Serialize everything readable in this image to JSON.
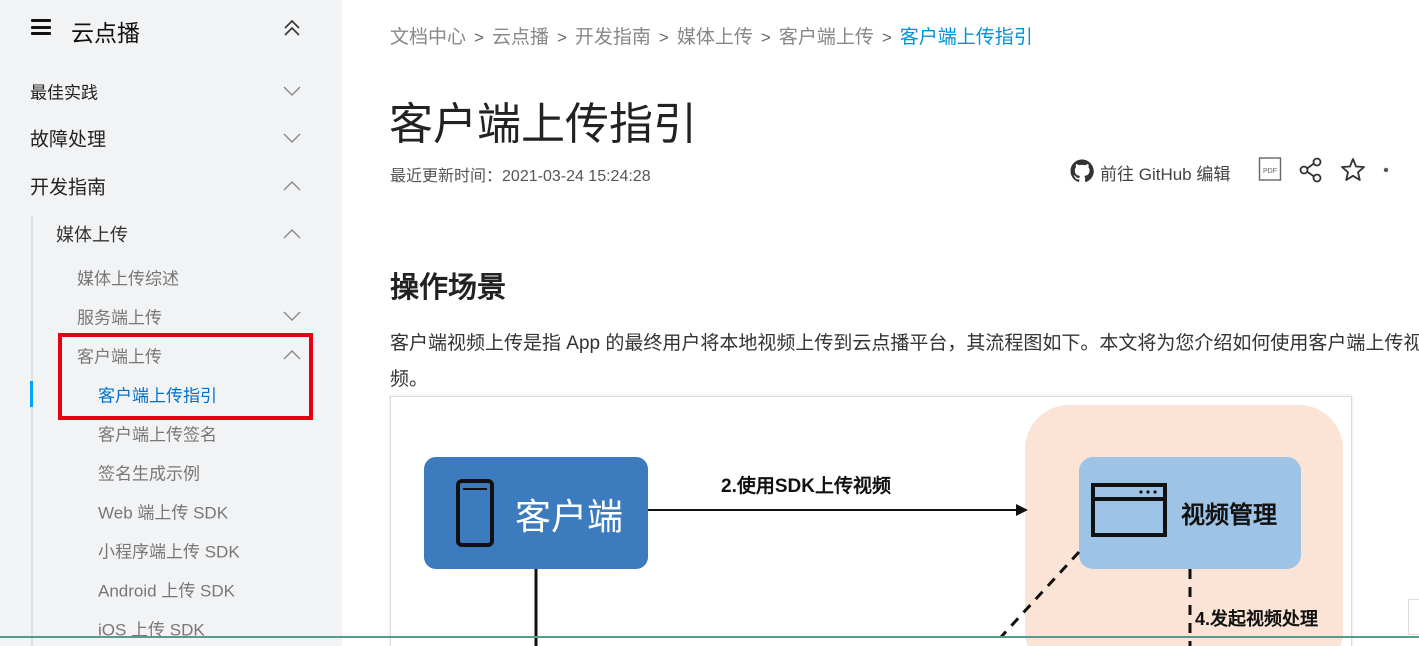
{
  "sidebar": {
    "title": "云点播",
    "items": [
      {
        "label": "最佳实践",
        "expanded": false
      },
      {
        "label": "故障处理",
        "expanded": false
      },
      {
        "label": "开发指南",
        "expanded": true
      },
      {
        "label": "媒体上传",
        "expanded": true
      },
      {
        "label": "媒体上传综述"
      },
      {
        "label": "服务端上传",
        "expanded": false
      },
      {
        "label": "客户端上传",
        "expanded": true
      },
      {
        "label": "客户端上传指引",
        "active": true
      },
      {
        "label": "客户端上传签名"
      },
      {
        "label": "签名生成示例"
      },
      {
        "label": "Web 端上传 SDK"
      },
      {
        "label": "小程序端上传 SDK"
      },
      {
        "label": "Android 上传 SDK"
      },
      {
        "label": "iOS 上传 SDK"
      }
    ]
  },
  "breadcrumb": [
    "文档中心",
    "云点播",
    "开发指南",
    "媒体上传",
    "客户端上传",
    "客户端上传指引"
  ],
  "page": {
    "title": "客户端上传指引",
    "updated_label": "最近更新时间：",
    "updated_time": "2021-03-24 15:24:28",
    "github_label": "前往 GitHub 编辑",
    "pdf_label": "PDF",
    "section_title": "操作场景",
    "paragraph": "客户端视频上传是指 App 的最终用户将本地视频上传到云点播平台，其流程图如下。本文将为您介绍如何使用客户端上传视频。"
  },
  "diagram": {
    "client_label": "客户端",
    "arrow_label": "2.使用SDK上传视频",
    "vod_label": "视频管理",
    "process_label": "4.发起视频处理"
  },
  "colors": {
    "accent": "#00a4ff",
    "highlight": "#e60012",
    "client_box": "#3d7bbf",
    "vod_bg": "#fbe4d5",
    "vod_box": "#9dc3e6"
  },
  "icons": [
    "hamburger-icon",
    "chevron-up-icon",
    "chevron-down-icon",
    "github-icon",
    "pdf-icon",
    "share-icon",
    "star-icon",
    "phone-icon",
    "window-icon"
  ]
}
